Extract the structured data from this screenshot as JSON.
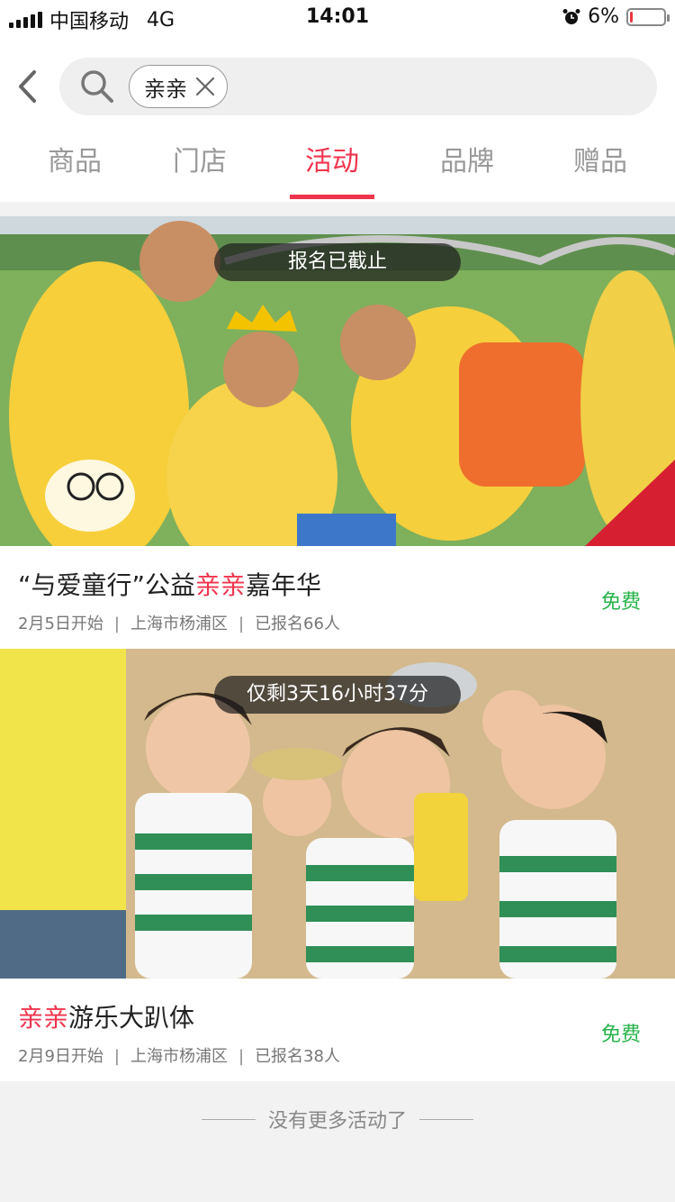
{
  "status_bar": {
    "carrier": "中国移动",
    "network": "4G",
    "time": "14:01",
    "battery_percent": "6%",
    "battery_level": 0.06,
    "icons": [
      "signal-icon",
      "alarm-icon",
      "battery-icon"
    ]
  },
  "search": {
    "tag_label": "亲亲",
    "icons": [
      "back-icon",
      "search-icon",
      "clear-tag-icon"
    ]
  },
  "tabs": [
    {
      "label": "商品",
      "active": false
    },
    {
      "label": "门店",
      "active": false
    },
    {
      "label": "活动",
      "active": true
    },
    {
      "label": "品牌",
      "active": false
    },
    {
      "label": "赠品",
      "active": false
    }
  ],
  "activities": [
    {
      "badge": "报名已截止",
      "title_parts": [
        "“与爱童行”公益",
        "亲亲",
        "嘉年华"
      ],
      "start": "2月5日开始",
      "location": "上海市杨浦区",
      "signed_up": "已报名66人",
      "price": "免费"
    },
    {
      "badge": "仅剩3天16小时37分",
      "title_parts": [
        "",
        "亲亲",
        "游乐大趴体"
      ],
      "start": "2月9日开始",
      "location": "上海市杨浦区",
      "signed_up": "已报名38人",
      "price": "免费"
    }
  ],
  "footer": {
    "no_more": "没有更多活动了"
  },
  "colors": {
    "accent": "#f0344d",
    "price_green": "#26b34a"
  }
}
